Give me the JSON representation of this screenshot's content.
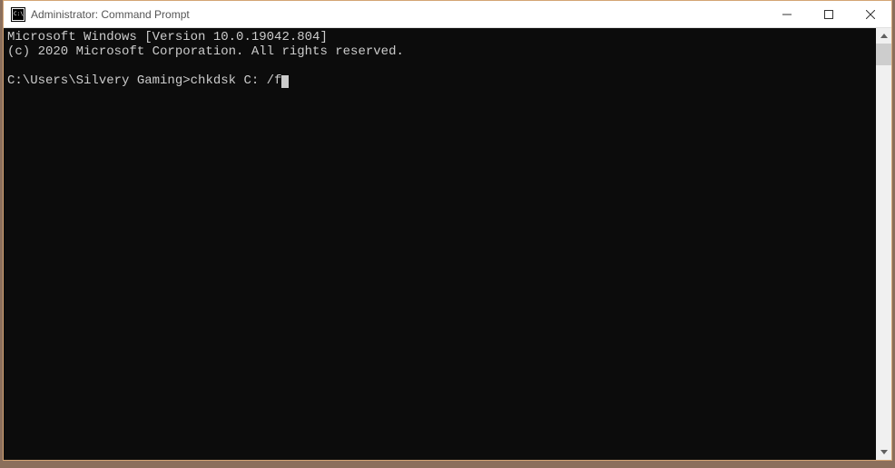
{
  "window": {
    "title": "Administrator: Command Prompt"
  },
  "console": {
    "line1": "Microsoft Windows [Version 10.0.19042.804]",
    "line2": "(c) 2020 Microsoft Corporation. All rights reserved.",
    "blank": "",
    "prompt": "C:\\Users\\Silvery Gaming>",
    "command": "chkdsk C: /f"
  }
}
